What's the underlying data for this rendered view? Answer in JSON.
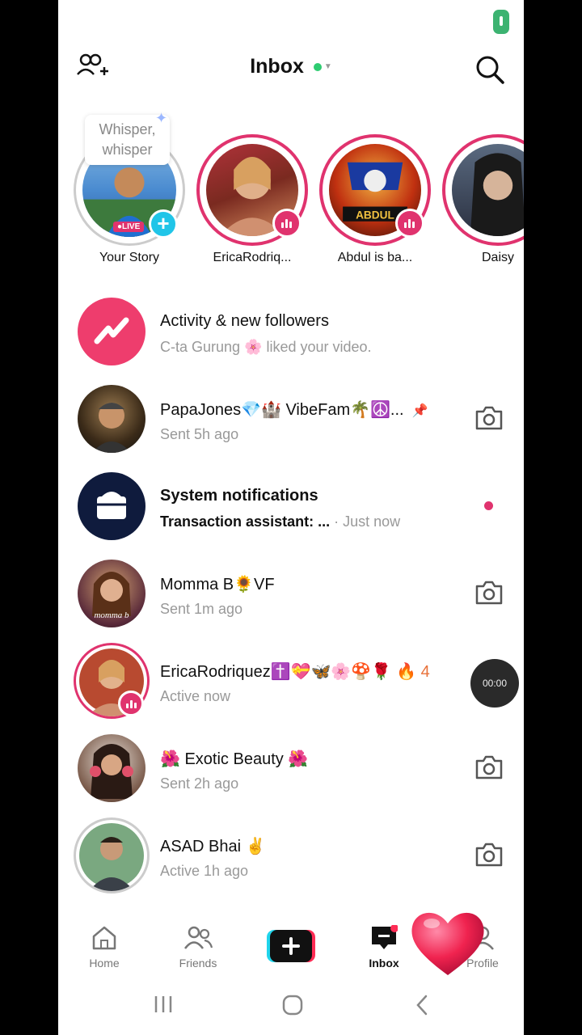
{
  "header": {
    "title": "Inbox"
  },
  "stories": [
    {
      "label": "Your Story",
      "tooltip_line1": "Whisper,",
      "tooltip_line2": "whisper",
      "live": "●LIVE"
    },
    {
      "label": "EricaRodriq..."
    },
    {
      "label": "Abdul is ba..."
    },
    {
      "label": "Daisy"
    }
  ],
  "rows": [
    {
      "name": "Activity & new followers",
      "sub": "C-ta Gurung 🌸 liked your video."
    },
    {
      "name": "PapaJones💎🏰 VibeFam🌴☮️...",
      "sub": "Sent 5h ago"
    },
    {
      "name": "System notifications",
      "sub": "Transaction assistant: ...",
      "time": "· Just now"
    },
    {
      "name": "Momma B🌻VF",
      "sub": "Sent 1m ago"
    },
    {
      "name": "EricaRodriquez✝️💝🦋🌸🍄🌹",
      "count": "🔥 4",
      "sub": "Active now",
      "timer": "00:00"
    },
    {
      "name": "🌺 Exotic Beauty 🌺",
      "sub": "Sent 2h ago"
    },
    {
      "name": "ASAD Bhai ✌️",
      "sub": "Active 1h ago"
    }
  ],
  "nav": {
    "home": "Home",
    "friends": "Friends",
    "inbox": "Inbox",
    "profile": "Profile"
  },
  "colors": {
    "accent": "#e0336e",
    "activity": "#ee3d6d",
    "system": "#0f1b3d",
    "online": "#2ecc71"
  }
}
